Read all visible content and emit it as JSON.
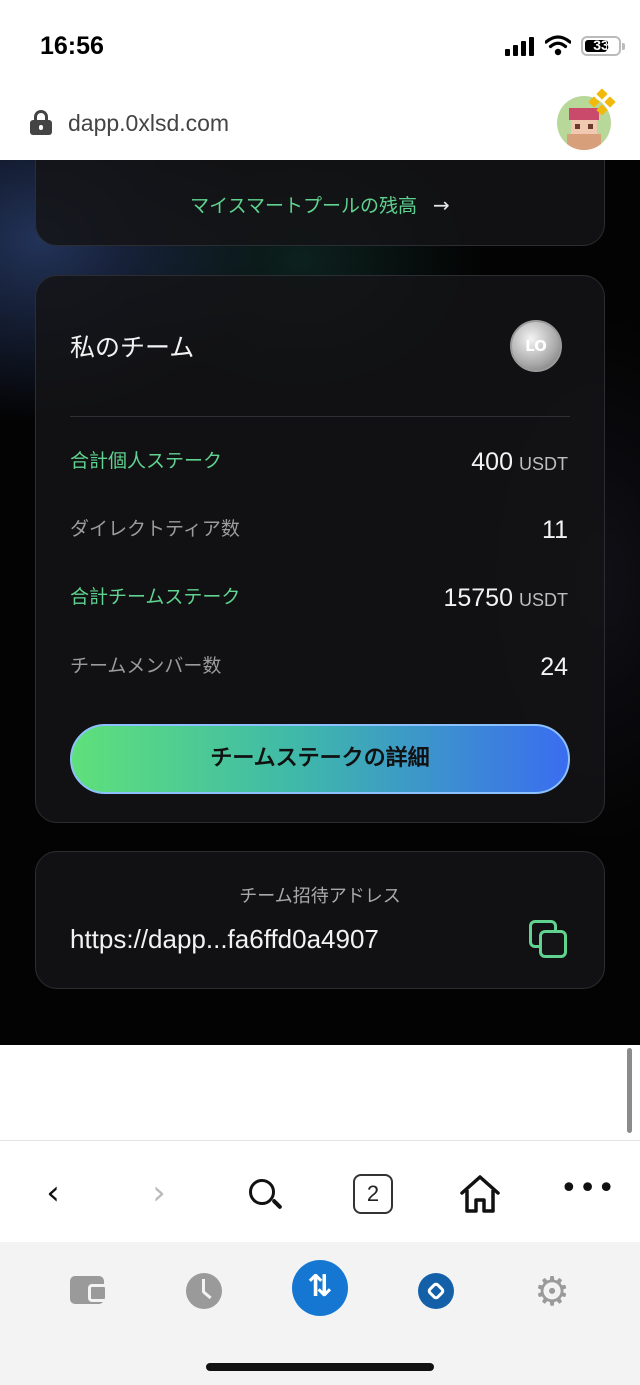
{
  "status_bar": {
    "time": "16:56",
    "battery": "33"
  },
  "browser": {
    "url": "dapp.0xlsd.com",
    "open_tabs": "2"
  },
  "pool_card": {
    "link_label": "マイスマートプールの残高",
    "link_arrow": "→"
  },
  "team_card": {
    "title": "私のチーム",
    "badge": "LO",
    "rows": [
      {
        "label": "合計個人ステーク",
        "value": "400",
        "unit": "USDT",
        "label_color": "green"
      },
      {
        "label": "ダイレクトティア数",
        "value": "11",
        "unit": "",
        "label_color": "gray"
      },
      {
        "label": "合計チームステーク",
        "value": "15750",
        "unit": "USDT",
        "label_color": "green"
      },
      {
        "label": "チームメンバー数",
        "value": "24",
        "unit": "",
        "label_color": "gray"
      }
    ],
    "details_button": "チームステークの詳細"
  },
  "invite_card": {
    "label": "チーム招待アドレス",
    "url": "https://dapp...fa6ffd0a4907"
  },
  "toolbar": {
    "back": "‹",
    "forward": "›",
    "more": "•••"
  },
  "bottom_nav": {
    "swap_symbol": "⇅",
    "settings_symbol": "⚙"
  },
  "colors": {
    "accent_green": "#5fd38f",
    "accent_blue": "#1677d2",
    "background": "#030303"
  }
}
